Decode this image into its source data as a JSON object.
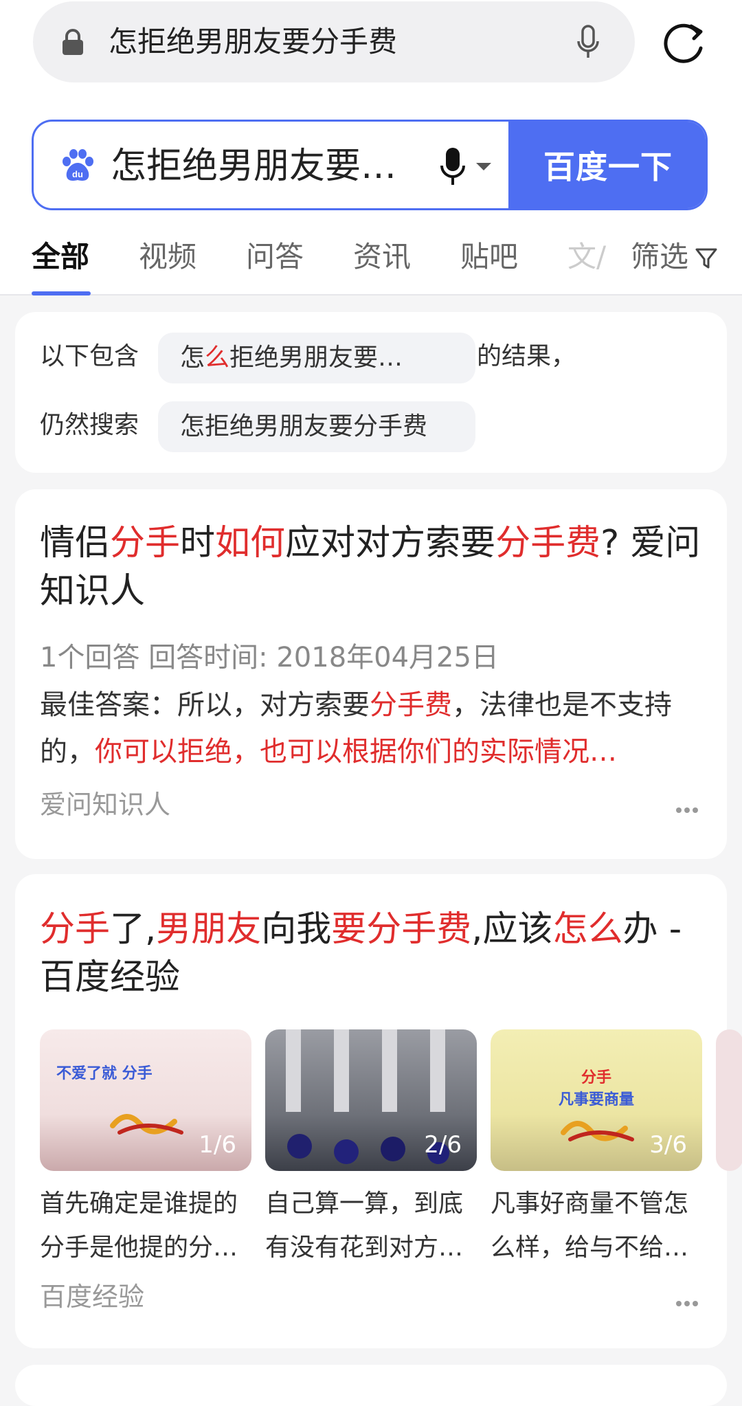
{
  "browser": {
    "url_text": "怎拒绝男朋友要分手费"
  },
  "search": {
    "query": "怎拒绝男朋友要…",
    "button_label": "百度一下",
    "paw_badge": "du"
  },
  "tabs": [
    {
      "label": "全部",
      "active": true
    },
    {
      "label": "视频"
    },
    {
      "label": "问答"
    },
    {
      "label": "资讯"
    },
    {
      "label": "贴吧"
    },
    {
      "label": "文/"
    }
  ],
  "filter_label": "筛选",
  "suggestion": {
    "prefix": "以下包含",
    "corrected_a": "怎",
    "corrected_red": "么",
    "corrected_b": "拒绝男朋友要…",
    "suffix": "的结果，",
    "still_label": "仍然搜索",
    "original": "怎拒绝男朋友要分手费"
  },
  "result1": {
    "title_parts": [
      {
        "t": "情侣",
        "hl": false
      },
      {
        "t": "分手",
        "hl": true
      },
      {
        "t": "时",
        "hl": false
      },
      {
        "t": "如何",
        "hl": true
      },
      {
        "t": "应对对方索要",
        "hl": false
      },
      {
        "t": "分手费",
        "hl": true
      },
      {
        "t": "? 爱问知识人",
        "hl": false
      }
    ],
    "meta": "1个回答  回答时间: 2018年04月25日",
    "answer_label": "最佳答案：所以，对方索要",
    "answer_hl1": "分手费",
    "answer_mid": "，法律也是不支持的，",
    "answer_hl2": "你可以拒绝，也可以根据你们的实际情况…",
    "source": "爱问知识人"
  },
  "result2": {
    "title_parts": [
      {
        "t": "分手",
        "hl": true
      },
      {
        "t": "了,",
        "hl": false
      },
      {
        "t": "男朋友",
        "hl": true
      },
      {
        "t": "向我",
        "hl": false
      },
      {
        "t": "要分手费",
        "hl": true
      },
      {
        "t": ",应该",
        "hl": false
      },
      {
        "t": "怎么",
        "hl": true
      },
      {
        "t": "办 - 百度经验",
        "hl": false
      }
    ],
    "thumbs": [
      {
        "index": "1/6",
        "caption1": "首先确定是谁提的",
        "caption2": "分手是他提的分…",
        "img_text1": "不爱了就 分手",
        "img_text2": "",
        "bg": "#f4e5e6"
      },
      {
        "index": "2/6",
        "caption1": "自己算一算，到底",
        "caption2": "有没有花到对方…",
        "img_text1": "",
        "img_text2": "",
        "bg": "#7b7e86"
      },
      {
        "index": "3/6",
        "caption1": "凡事好商量不管怎",
        "caption2": "么样，给与不给…",
        "img_text1": "分手",
        "img_text2": "凡事要商量",
        "bg": "#efe9a8"
      }
    ],
    "source": "百度经验"
  },
  "colors": {
    "accent": "#4e6ef2",
    "highlight": "#e02d2d"
  }
}
